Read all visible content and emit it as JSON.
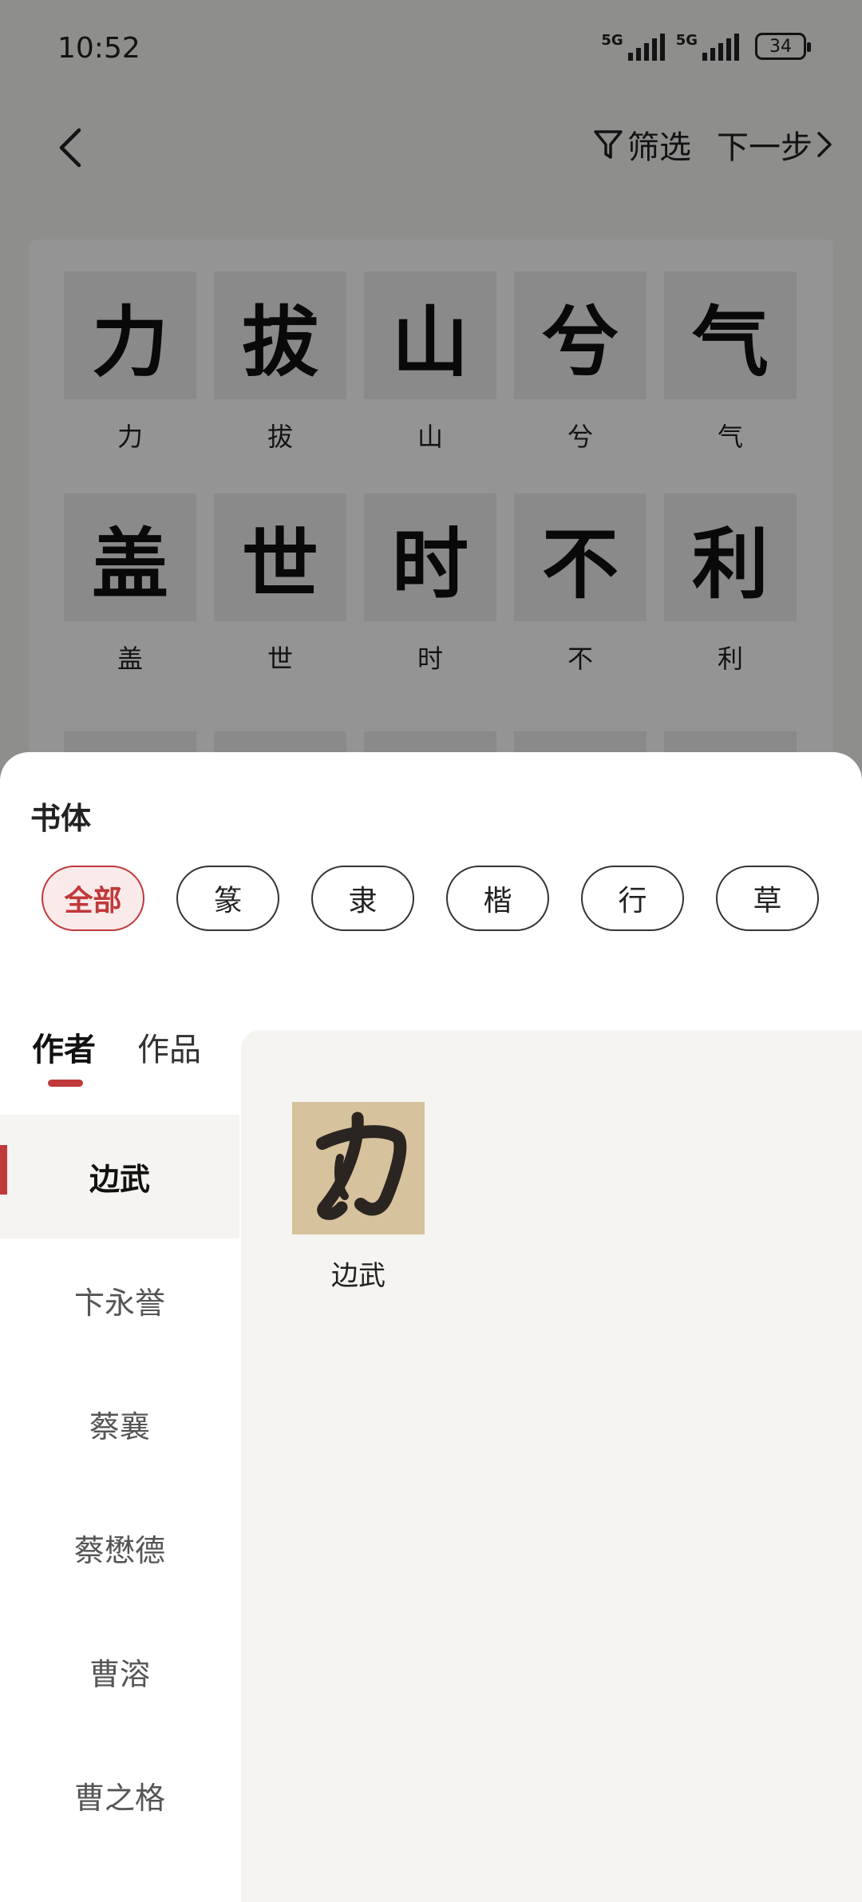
{
  "status_bar": {
    "time": "10:52",
    "signal1": "5G",
    "signal2": "5G",
    "battery": "34"
  },
  "nav": {
    "filter_label": "筛选",
    "next_label": "下一步"
  },
  "characters": [
    {
      "char": "力",
      "label": "力"
    },
    {
      "char": "拔",
      "label": "拔"
    },
    {
      "char": "山",
      "label": "山"
    },
    {
      "char": "兮",
      "label": "兮"
    },
    {
      "char": "气",
      "label": "气"
    },
    {
      "char": "盖",
      "label": "盖"
    },
    {
      "char": "世",
      "label": "世"
    },
    {
      "char": "时",
      "label": "时"
    },
    {
      "char": "不",
      "label": "不"
    },
    {
      "char": "利",
      "label": "利"
    }
  ],
  "sheet": {
    "title": "书体",
    "scripts": [
      "全部",
      "篆",
      "隶",
      "楷",
      "行",
      "草"
    ],
    "selected_script": "全部",
    "tabs": [
      "作者",
      "作品"
    ],
    "active_tab": "作者",
    "authors": [
      "边武",
      "卞永誉",
      "蔡襄",
      "蔡懋德",
      "曹溶",
      "曹之格"
    ],
    "selected_author": "边武",
    "works": [
      {
        "label": "边武",
        "thumb_char": "力"
      }
    ]
  },
  "colors": {
    "accent": "#c0393b",
    "panel_bg": "#f5f4f1"
  }
}
